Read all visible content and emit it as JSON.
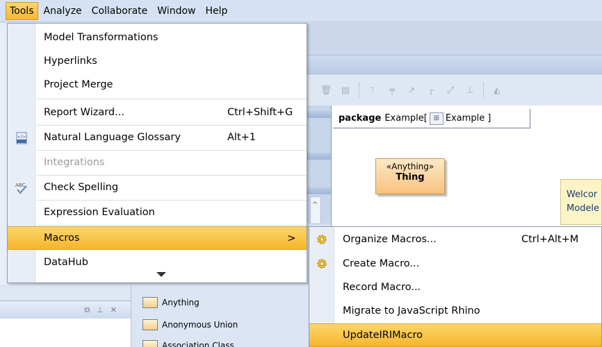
{
  "menubar": {
    "items": [
      "Tools",
      "Analyze",
      "Collaborate",
      "Window",
      "Help"
    ]
  },
  "tools_menu": {
    "items": [
      {
        "label": "Model Transformations",
        "shortcut": "",
        "icon": ""
      },
      {
        "label": "Hyperlinks",
        "shortcut": "",
        "icon": ""
      },
      {
        "label": "Project Merge",
        "shortcut": "",
        "icon": ""
      },
      {
        "label": "Report Wizard...",
        "shortcut": "Ctrl+Shift+G",
        "icon": ""
      },
      {
        "label": "Natural Language Glossary",
        "shortcut": "Alt+1",
        "icon": "html-glossary-icon"
      },
      {
        "label": "Integrations",
        "shortcut": "",
        "icon": "",
        "disabled": true
      },
      {
        "label": "Check Spelling",
        "shortcut": "",
        "icon": "spell-check-icon"
      },
      {
        "label": "Expression Evaluation",
        "shortcut": "",
        "icon": ""
      },
      {
        "label": "Macros",
        "shortcut": "",
        "icon": "",
        "highlighted": true,
        "submenu_arrow": ">"
      },
      {
        "label": "DataHub",
        "shortcut": "",
        "icon": ""
      }
    ],
    "more_indicator": "chevron-down-icon"
  },
  "macros_submenu": {
    "items": [
      {
        "label": "Organize Macros...",
        "shortcut": "Ctrl+Alt+M",
        "icon": "gear-icon"
      },
      {
        "label": "Create Macro...",
        "shortcut": "",
        "icon": "gear-icon"
      },
      {
        "label": "Record Macro...",
        "shortcut": "",
        "icon": ""
      },
      {
        "label": "Migrate to JavaScript Rhino",
        "shortcut": "",
        "icon": ""
      },
      {
        "label": "UpdateIRIMacro",
        "shortcut": "",
        "icon": "",
        "highlighted": true
      }
    ]
  },
  "diagram": {
    "tab_keyword": "package",
    "tab_name": "Example",
    "tab_prefix": "[",
    "tab_ref": "Example",
    "tab_suffix": "]",
    "element": {
      "stereotype": "«Anything»",
      "name": "Thing"
    },
    "note_lines": [
      "Welcor",
      "Modele"
    ]
  },
  "palette": {
    "items": [
      "Anything",
      "Anonymous Union",
      "Association Class"
    ]
  },
  "left_panel": {
    "header_icons": [
      "pin-icon",
      "float-icon",
      "close-icon"
    ]
  },
  "colors": {
    "highlight": "#f8c13f",
    "menubar_bg": "#d6e2f3",
    "thing_fill": "#f8c27e"
  }
}
